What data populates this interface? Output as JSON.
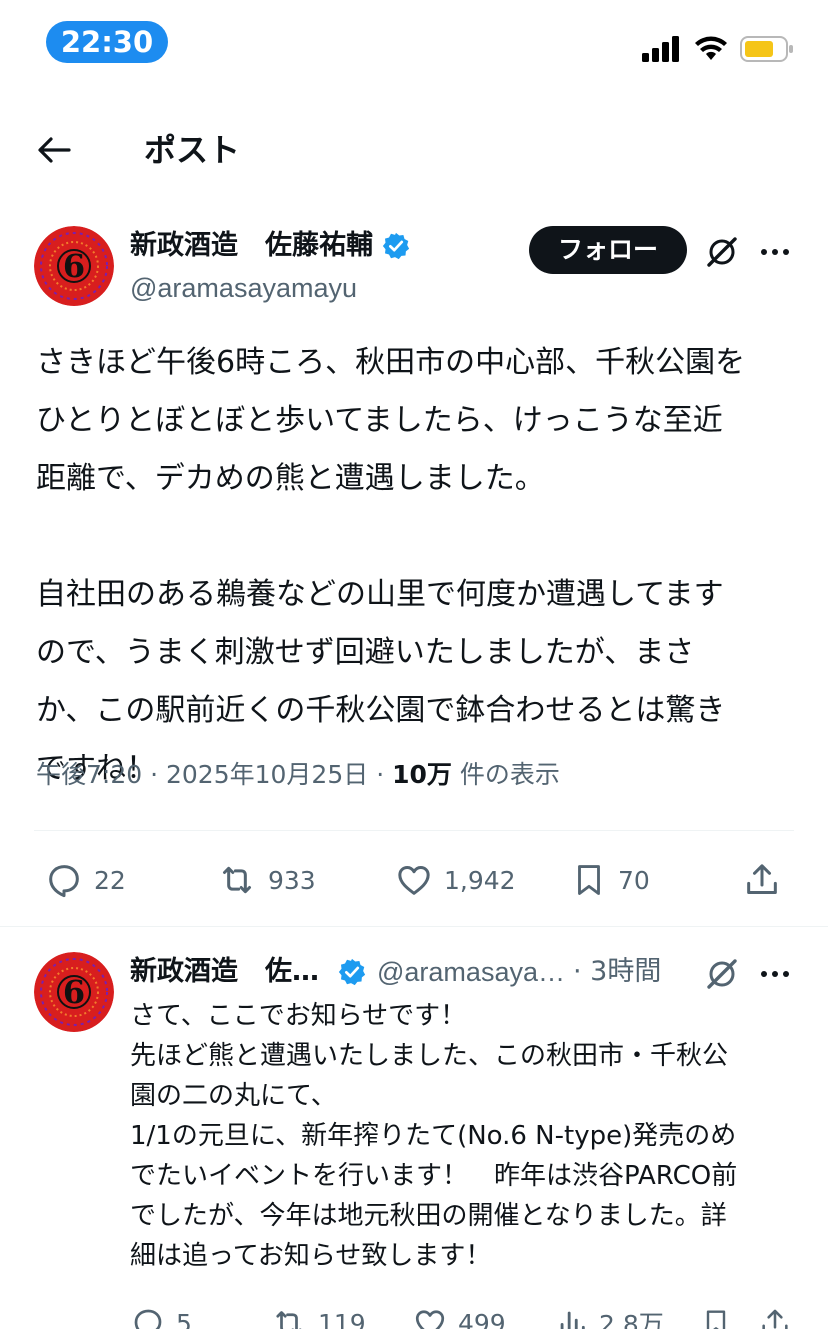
{
  "status_bar": {
    "time": "22:30"
  },
  "header": {
    "title": "ポスト"
  },
  "post": {
    "author_name": "新政酒造　佐藤祐輔",
    "author_handle": "@aramasayamayu",
    "follow_label": "フォロー",
    "text": "さきほど午後6時ころ、秋田市の中心部、千秋公園を\nひとりとぼとぼと歩いてましたら、けっこうな至近\n距離で、デカめの熊と遭遇しました。\n\n自社田のある鵜養などの山里で何度か遭遇してます\nので、うまく刺激せず回避いたしましたが、まさ\nか、この駅前近くの千秋公園で鉢合わせるとは驚き\nですね！",
    "time": "午後7:20",
    "date": "2025年10月25日",
    "views_count": "10万",
    "views_label": "件の表示",
    "sep": "·",
    "replies": "22",
    "reposts": "933",
    "likes": "1,942",
    "bookmarks": "70"
  },
  "reply": {
    "author_name": "新政酒造　佐…",
    "author_handle": "@aramasaya…",
    "time": "· 3時間",
    "text": "さて、ここでお知らせです！\n先ほど熊と遭遇いたしました、この秋田市・千秋公\n園の二の丸にて、\n1/1の元旦に、新年搾りたて(No.6 N-type)発売のめ\nでたいイベントを行います！　昨年は渋谷PARCO前\nでしたが、今年は地元秋田の開催となりました。詳\n細は追ってお知らせ致します！",
    "replies": "5",
    "reposts": "119",
    "likes": "499",
    "views": "2.8万"
  },
  "avatar_text": "6",
  "colors": {
    "accent": "#1d9bf0",
    "avatar_bg": "#d81e1e",
    "text": "#0f1419",
    "muted": "#536471"
  }
}
